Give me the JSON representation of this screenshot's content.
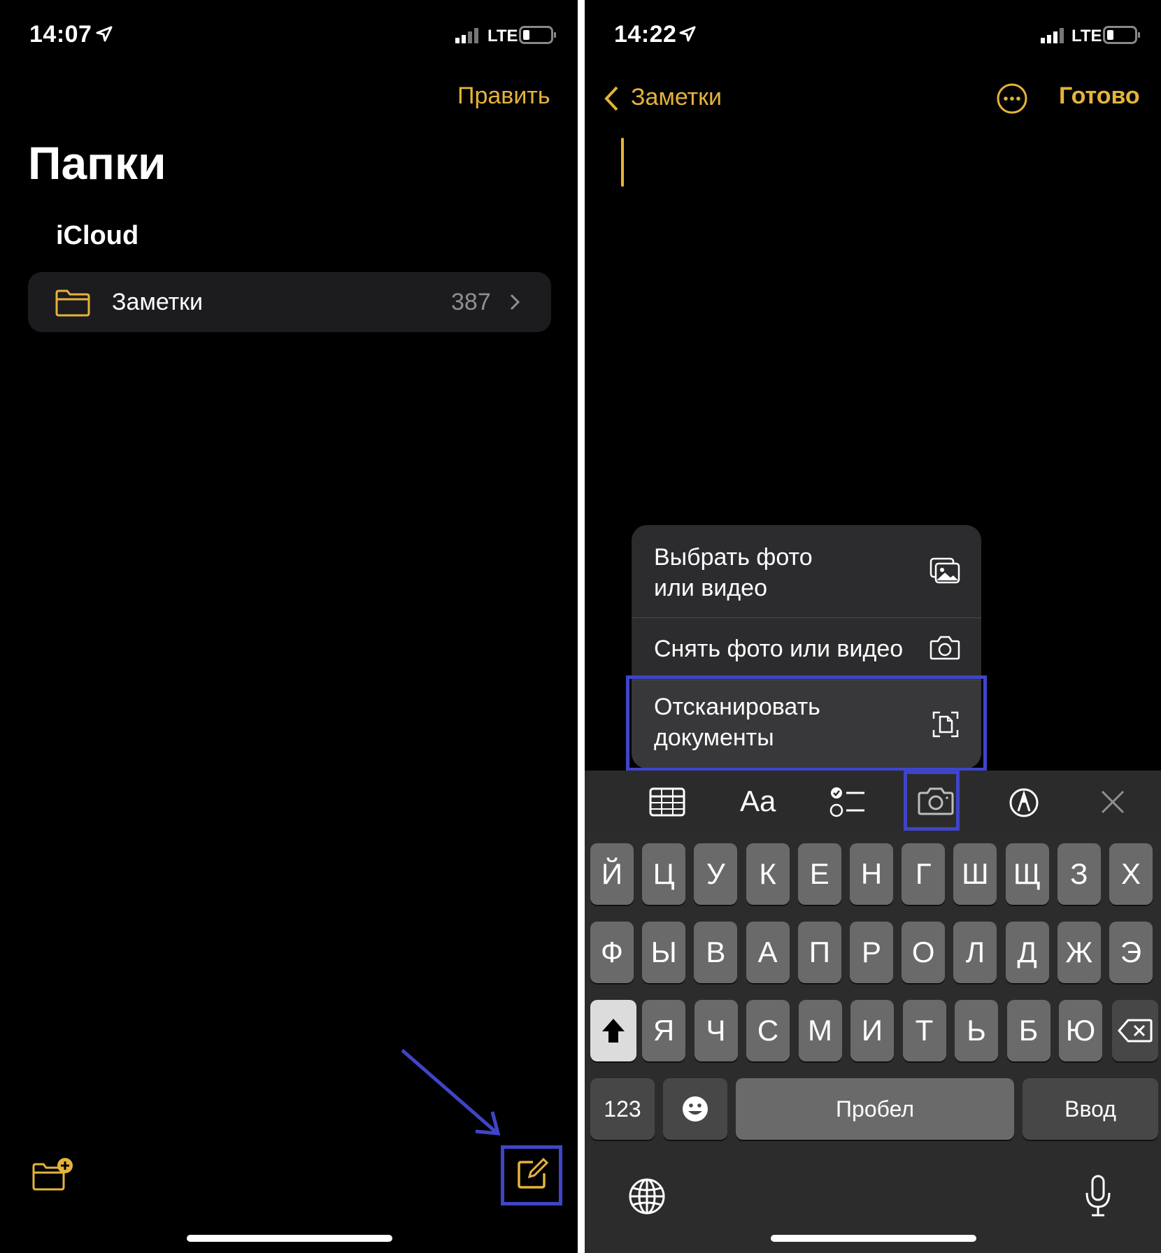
{
  "left": {
    "status": {
      "time": "14:07",
      "network": "LTE"
    },
    "nav": {
      "edit": "Править"
    },
    "title": "Папки",
    "section": "iCloud",
    "folder": {
      "name": "Заметки",
      "count": "387"
    },
    "toolbar": {
      "new_folder_icon": "folder-plus-icon",
      "compose_icon": "compose-icon"
    }
  },
  "right": {
    "status": {
      "time": "14:22",
      "network": "LTE"
    },
    "nav": {
      "back": "Заметки",
      "done": "Готово"
    },
    "menu": {
      "items": [
        {
          "label_line1": "Выбрать фото",
          "label_line2": "или видео",
          "icon": "photo-library-icon"
        },
        {
          "label_line1": "Снять фото или видео",
          "label_line2": "",
          "icon": "camera-icon"
        },
        {
          "label_line1": "Отсканировать",
          "label_line2": "документы",
          "icon": "scan-document-icon"
        }
      ]
    },
    "format_toolbar": {
      "text_style": "Aa"
    },
    "keyboard": {
      "row1": [
        "Й",
        "Ц",
        "У",
        "К",
        "Е",
        "Н",
        "Г",
        "Ш",
        "Щ",
        "З",
        "Х"
      ],
      "row2": [
        "Ф",
        "Ы",
        "В",
        "А",
        "П",
        "Р",
        "О",
        "Л",
        "Д",
        "Ж",
        "Э"
      ],
      "row3": [
        "Я",
        "Ч",
        "С",
        "М",
        "И",
        "Т",
        "Ь",
        "Б",
        "Ю"
      ],
      "numbers": "123",
      "space": "Пробел",
      "enter": "Ввод"
    }
  },
  "colors": {
    "accent": "#e5b33b",
    "highlight": "#3f45c9"
  }
}
